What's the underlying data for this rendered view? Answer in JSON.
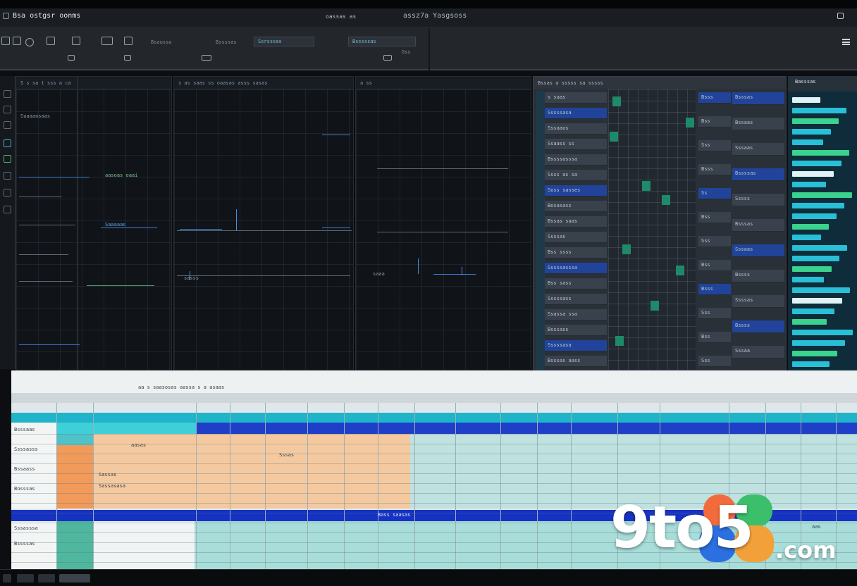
{
  "titlebar": {
    "app_title": "Bsa ostgsr oonms",
    "center_text": "oassas as",
    "right_text": "assz7a Yasgsoss"
  },
  "toolbar": {
    "labels": [
      "Bsaussa",
      "Bssssas",
      "Ssrsssas",
      "Bsssssas",
      "Gss"
    ]
  },
  "panes": {
    "pane1_header": "S s sa  t sss  a ca",
    "pane2_header": "s  as saas ss  oaasas  asss sasas",
    "pane3_header": "a  ss",
    "pane1_labels": [
      "aasoas oaai",
      "Suaaaosaas",
      "Saaaaas"
    ],
    "pane2_labels": [
      "sasss"
    ],
    "pane3_labels": [
      "saaa"
    ]
  },
  "list": {
    "header": "Bssas  a sssss  sa sssss",
    "items": [
      "s saas",
      "Sssssasa",
      "Sssaaos",
      "Ssaass ss",
      "Bssssasssa",
      "Ssss as sa",
      "Soss sasses",
      "Bosasass",
      "Bssas saas",
      "Ssssas",
      "Bss ssss",
      "Sssssasssa",
      "Bss sass",
      "Sssssass",
      "Ssassa ssa",
      "Bsssass",
      "Sssssasa",
      "Bsssas aass"
    ],
    "col2_items": [
      "Bsss",
      "Bss",
      "Sss",
      "Bsss",
      "Ss",
      "Bss",
      "Sss",
      "Bss",
      "Bsss",
      "Sss",
      "Bss",
      "Sss"
    ],
    "col3_items": [
      "Bsssas",
      "Bssaas",
      "Sssaas",
      "Bssssas",
      "Sssss",
      "Bsssas",
      "Sssaas",
      "Bssss",
      "Ssssas",
      "Bssss",
      "Sssaa"
    ]
  },
  "right_panel": {
    "header": "Basssas"
  },
  "sheet": {
    "header_text": "aa s saasosas  aassa  s a asaas",
    "row_labels": [
      "Bsssaas",
      "Ssssasss",
      "Bssaass",
      "Bosssas",
      "Sssasssa",
      "Bssssas"
    ],
    "blue_band_text": "Bass saasas",
    "cells": [
      "aasas",
      "Sassas",
      "Sassasasa",
      "Sssas",
      "aas"
    ]
  },
  "watermark": {
    "brand": "9to5",
    "suffix": ".com"
  },
  "colors": {
    "accent_blue": "#1e3fc4",
    "accent_cyan": "#29bfd6",
    "accent_green": "#3bd18e",
    "brand_orange": "#f26b3a",
    "brand_blue": "#2b6fe0",
    "brand_green": "#3bbf6a"
  }
}
